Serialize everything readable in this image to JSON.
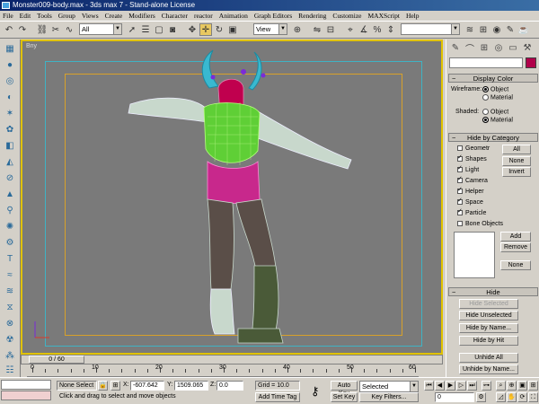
{
  "title": "Monster009-body.max - 3ds max 7 - Stand-alone License",
  "menu": [
    "File",
    "Edit",
    "Tools",
    "Group",
    "Views",
    "Create",
    "Modifiers",
    "Character",
    "reactor",
    "Animation",
    "Graph Editors",
    "Rendering",
    "Customize",
    "MAXScript",
    "Help"
  ],
  "toolbar": {
    "selection_filter": "All",
    "coord_system": "View"
  },
  "viewport": {
    "label": "Bny"
  },
  "command_panel": {
    "display_color": {
      "header": "Display Color",
      "wireframe_label": "Wireframe:",
      "shaded_label": "Shaded:",
      "wireframe_options": [
        "Object",
        "Material"
      ],
      "shaded_options": [
        "Object",
        "Material"
      ],
      "wireframe_selected": "Object",
      "shaded_selected": "Material"
    },
    "hide_by_category": {
      "header": "Hide by Category",
      "items": [
        {
          "label": "Geometr",
          "checked": false
        },
        {
          "label": "Shapes",
          "checked": true
        },
        {
          "label": "Light",
          "checked": true
        },
        {
          "label": "Camera",
          "checked": true
        },
        {
          "label": "Helper",
          "checked": true
        },
        {
          "label": "Space",
          "checked": true
        },
        {
          "label": "Particle",
          "checked": true
        },
        {
          "label": "Bone Objects",
          "checked": false
        }
      ],
      "all_btn": "All",
      "none_btn": "None",
      "invert_btn": "Invert",
      "add_btn": "Add",
      "remove_btn": "Remove",
      "none2_btn": "None"
    },
    "hide": {
      "header": "Hide",
      "hide_selected": "Hide Selected",
      "hide_unselected": "Hide Unselected",
      "hide_by_name": "Hide by Name...",
      "hide_by_hit": "Hide by Hit",
      "unhide_all": "Unhide All",
      "unhide_by_name": "Unhide by Name..."
    }
  },
  "timeline": {
    "frame_label": "0 / 60",
    "ticks": [
      "0",
      "10",
      "20",
      "30",
      "40",
      "50",
      "60"
    ]
  },
  "status": {
    "selection": "None Select",
    "x_label": "X:",
    "x_value": "-607.642",
    "y_label": "Y:",
    "y_value": "1509.065",
    "z_label": "Z:",
    "z_value": "0.0",
    "grid": "Grid = 10.0",
    "prompt": "Click and drag to select and move objects",
    "add_time_tag": "Add Time Tag",
    "auto_key": "Auto Key",
    "key_mode": "Selected",
    "set_key": "Set Key",
    "key_filters": "Key Filters...",
    "frame_value": "0"
  }
}
